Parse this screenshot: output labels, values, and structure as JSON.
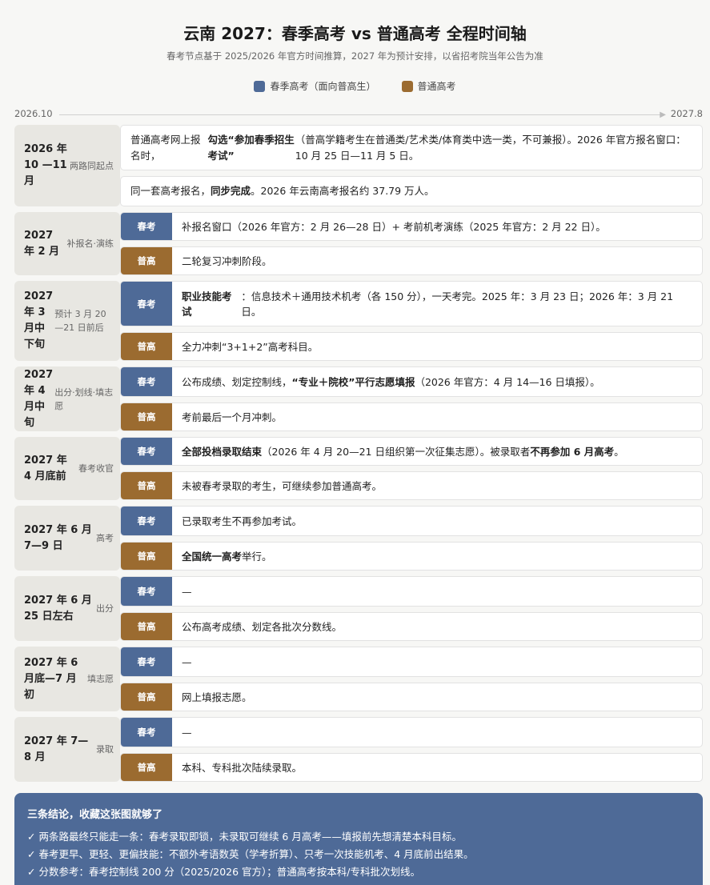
{
  "title": "云南 2027：春季高考 vs 普通高考 全程时间轴",
  "subtitle": "春考节点基于 2025/2026 年官方时间推算，2027 年为预计安排，以省招考院当年公告为准",
  "legend": {
    "spring": "春季高考（面向普高生）",
    "normal": "普通高考",
    "spring_color": "#4e6a97",
    "normal_color": "#9b6b30"
  },
  "axis": {
    "start": "2026.10",
    "end": "2027.8"
  },
  "badges": {
    "spring": "春考",
    "normal": "普高"
  },
  "stages": [
    {
      "date": "2026 年 10 —11 月",
      "tag": "两路同起点",
      "rows": [
        {
          "segments": [
            {
              "t": "普通高考网上报名时，"
            },
            {
              "t": "勾选“参加春季招生考试”",
              "b": true
            },
            {
              "t": "（普高学籍考生在普通类/艺术类/体育类中选一类，不可兼报）。2026 年官方报名窗口：10 月 25 日—11 月 5 日。"
            }
          ]
        },
        {
          "segments": [
            {
              "t": "同一套高考报名，"
            },
            {
              "t": "同步完成",
              "b": true
            },
            {
              "t": "。2026 年云南高考报名约 37.79 万人。"
            }
          ]
        }
      ]
    },
    {
      "date": "2027 年 2 月",
      "tag": "补报名·演练",
      "spring": [
        {
          "t": "补报名窗口（2026 年官方：2 月 26—28 日）+ 考前机考演练（2025 年官方：2 月 22 日）。"
        }
      ],
      "normal": [
        {
          "t": "二轮复习冲刺阶段。"
        }
      ]
    },
    {
      "date": "2027 年 3 月中下旬",
      "tag": "预计 3 月 20—21 日前后",
      "spring": [
        {
          "t": "职业技能考试",
          "b": true
        },
        {
          "t": "：信息技术＋通用技术机考（各 150 分），一天考完。2025 年：3 月 23 日；2026 年：3 月 21 日。"
        }
      ],
      "normal": [
        {
          "t": "全力冲刺“3+1+2”高考科目。"
        }
      ]
    },
    {
      "date": "2027 年 4 月中旬",
      "tag": "出分·划线·填志愿",
      "spring": [
        {
          "t": "公布成绩、划定控制线，"
        },
        {
          "t": "“专业＋院校”平行志愿填报",
          "b": true
        },
        {
          "t": "（2026 年官方：4 月 14—16 日填报）。"
        }
      ],
      "normal": [
        {
          "t": "考前最后一个月冲刺。"
        }
      ]
    },
    {
      "date": "2027 年 4 月底前",
      "tag": "春考收官",
      "spring": [
        {
          "t": "全部投档录取结束",
          "b": true
        },
        {
          "t": "（2026 年 4 月 20—21 日组织第一次征集志愿）。被录取者"
        },
        {
          "t": "不再参加 6 月高考",
          "b": true
        },
        {
          "t": "。"
        }
      ],
      "normal": [
        {
          "t": "未被春考录取的考生，可继续参加普通高考。"
        }
      ]
    },
    {
      "date": "2027 年 6 月 7—9 日",
      "tag": "高考",
      "spring": [
        {
          "t": "已录取考生不再参加考试。"
        }
      ],
      "normal": [
        {
          "t": "全国统一高考",
          "b": true
        },
        {
          "t": "举行。"
        }
      ]
    },
    {
      "date": "2027 年 6 月 25 日左右",
      "tag": "出分",
      "spring": [
        {
          "t": "—"
        }
      ],
      "normal": [
        {
          "t": "公布高考成绩、划定各批次分数线。"
        }
      ]
    },
    {
      "date": "2027 年 6 月底—7 月初",
      "tag": "填志愿",
      "spring": [
        {
          "t": "—"
        }
      ],
      "normal": [
        {
          "t": "网上填报志愿。"
        }
      ]
    },
    {
      "date": "2027 年 7—8 月",
      "tag": "录取",
      "spring": [
        {
          "t": "—"
        }
      ],
      "normal": [
        {
          "t": "本科、专科批次陆续录取。"
        }
      ]
    }
  ],
  "summary": {
    "title": "三条结论，收藏这张图就够了",
    "items": [
      "✓ 两条路最终只能走一条：春考录取即锁，未录取可继续 6 月高考——填报前先想清楚本科目标。",
      "✓ 春考更早、更轻、更偏技能：不额外考语数英（学考折算）、只考一次技能机考、4 月底前出结果。",
      "✓ 分数参考：春考控制线 200 分（2025/2026 官方）；普通高考按本科/专科批次划线。"
    ]
  }
}
